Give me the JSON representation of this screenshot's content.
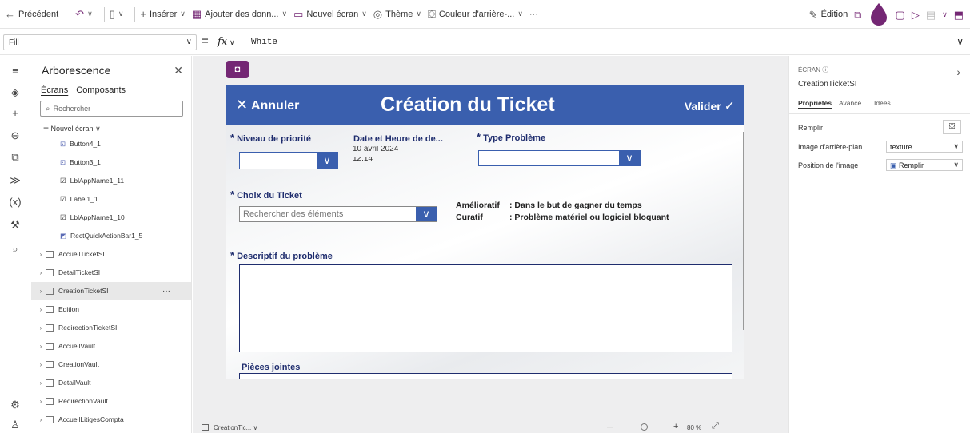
{
  "toolbar": {
    "back": "Précédent",
    "insert": "Insérer",
    "add_data": "Ajouter des donn...",
    "new_screen": "Nouvel écran",
    "theme": "Thème",
    "bg_color": "Couleur d'arrière-...",
    "more": "···",
    "edition": "Édition"
  },
  "formula": {
    "property": "Fill",
    "equals": "=",
    "fx": "fx",
    "value": "White"
  },
  "tree": {
    "title": "Arborescence",
    "tab_screens": "Écrans",
    "tab_components": "Composants",
    "search_placeholder": "Rechercher",
    "new_screen": "Nouvel écran",
    "items": [
      "Button4_1",
      "Button3_1",
      "LblAppName1_11",
      "Label1_1",
      "LblAppName1_10",
      "RectQuickActionBar1_5",
      "AccueilTicketSI",
      "DetailTicketSI",
      "CreationTicketSI",
      "Edition",
      "RedirectionTicketSI",
      "AccueilVault",
      "CreationVault",
      "DetailVault",
      "RedirectionVault",
      "AccueilLitigesCompta"
    ],
    "item_menu": "···"
  },
  "form": {
    "cancel": "Annuler",
    "title": "Création du Ticket",
    "validate": "Valider",
    "priority_label": "Niveau de priorité",
    "date_label": "Date et Heure de de...",
    "date_value_1": "10 avril 2024",
    "date_value_2": "12:14",
    "type_label": "Type Problème",
    "choice_label": "Choix du Ticket",
    "choice_placeholder": "Rechercher des éléments",
    "amelioratif_key": "Amélioratif",
    "amelioratif_val": ": Dans le but de gagner du temps",
    "curatif_key": "Curatif",
    "curatif_val": ": Problème matériel ou logiciel bloquant",
    "desc_label": "Descriptif du problème",
    "attach_label": "Pièces jointes",
    "required_mark": "*"
  },
  "bottom": {
    "screen_name": "CreationTic...",
    "zoom_minus": "—",
    "zoom_plus": "+",
    "zoom": "80 %"
  },
  "props": {
    "kind": "ÉCRAN",
    "name": "CreationTicketSI",
    "tab_props": "Propriétés",
    "tab_adv": "Avancé",
    "tab_ideas": "Idées",
    "fill_label": "Remplir",
    "bg_image_label": "Image d'arrière-plan",
    "bg_image_value": "texture",
    "image_pos_label": "Position de l'image",
    "image_pos_value": "Remplir"
  },
  "colors": {
    "header_blue": "#3a5fae",
    "label_navy": "#1f2d6e",
    "brand_purple": "#742774"
  }
}
